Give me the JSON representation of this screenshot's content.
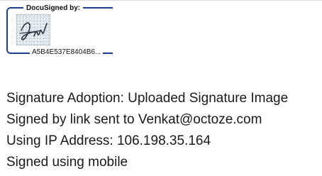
{
  "signature": {
    "header": "DocuSigned by:",
    "envelope_id": "A5B4E537E8404B6...",
    "image": "uploaded-handwritten-signature",
    "accent_color": "#1f3f8f"
  },
  "details": [
    "Signature Adoption: Uploaded Signature Image",
    "Signed by link sent to Venkat@octoze.com",
    "Using IP Address: 106.198.35.164",
    "Signed using mobile"
  ]
}
